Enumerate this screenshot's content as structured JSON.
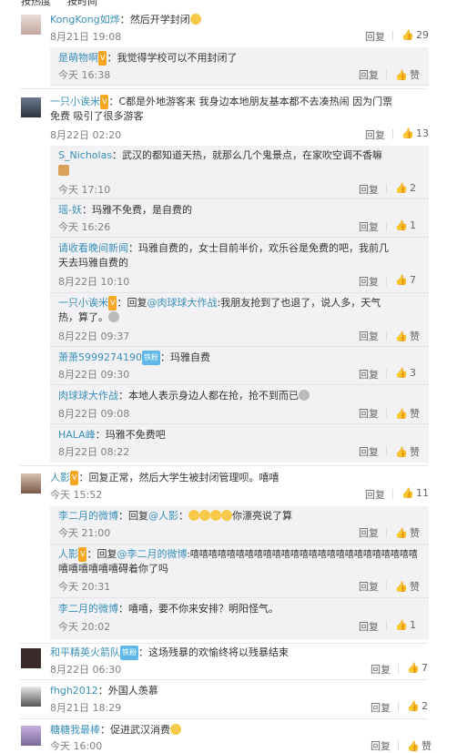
{
  "tabs": [
    "按热度",
    "按时间"
  ],
  "ui": {
    "reply": "回复",
    "zan": "赞"
  },
  "c1": {
    "name": "KongKong如烨",
    "text": "：然后开学封闭",
    "time": "8月21日 19:08",
    "likes": "29",
    "replies": [
      {
        "name": "是萌物啊",
        "text": "：我觉得学校可以不用封闭了",
        "time": "今天 16:38"
      }
    ]
  },
  "c2": {
    "name": "一只小诶米",
    "text1": "：C都是外地游客来 我身边本地朋友基本都不去凑热闹 因为门票",
    "text2": "免费 吸引了很多游客",
    "time": "8月22日 02:20",
    "likes": "13",
    "replies": [
      {
        "name": "S_Nicholas",
        "text": "：武汉的都知道天热，就那么几个鬼景点，在家吹空调不香嘛",
        "time": "今天 17:10",
        "likes": "2"
      },
      {
        "name": "瑶-妖",
        "text": "：玛雅不免费，是自费的",
        "time": "今天 16:26",
        "likes": "1"
      },
      {
        "name": "请收看晚间新闻",
        "text1": "：玛雅自费的，女士目前半价，欢乐谷是免费的吧，我前几",
        "text2": "天去玛雅自费的",
        "time": "8月22日 10:10",
        "likes": "7"
      },
      {
        "name": "一只小诶米",
        "reply_prefix": "：回复",
        "at": "@肉球球大作战",
        "text1": ":我朋友抢到了也退了，说人多，天气",
        "text2": "热，算了。",
        "time": "8月22日 09:37"
      },
      {
        "name": "萧萧5999274190",
        "text": "：玛雅自费",
        "time": "8月22日 09:30",
        "likes": "3"
      },
      {
        "name": "肉球球大作战",
        "text": "：本地人表示身边人都在抢，抢不到而已",
        "time": "8月22日 09:08"
      },
      {
        "name": "HALA峰",
        "text": "：玛雅不免费吧",
        "time": "8月22日 08:22"
      }
    ]
  },
  "c3": {
    "name": "人影",
    "text": "：回复正常，然后大学生被封闭管理呗。嘻嘻",
    "time": "今天 15:52",
    "likes": "11",
    "replies": [
      {
        "name": "李二月的微博",
        "reply_prefix": "：回复",
        "at": "@人影",
        "text": "：",
        "text_end": "你漂亮说了算",
        "time": "今天 21:00"
      },
      {
        "name": "人影",
        "reply_prefix": "：回复",
        "at": "@李二月的微博",
        "text1": ":嘻嘻嘻嘻嘻嘻嘻嘻嘻嘻嘻嘻嘻嘻嘻嘻嘻嘻嘻嘻嘻嘻嘻嘻嘻",
        "text2": "嘻嘻嘻嘻嘻嘻碍着你了吗",
        "time": "今天 20:31"
      },
      {
        "name": "李二月的微博",
        "text": "：嘻嘻，要不你来安排？明阳怪气。",
        "time": "今天 20:02",
        "likes": "1"
      }
    ]
  },
  "c4": {
    "name": "和平精英火箭队",
    "text": "：这场残暴的欢愉终将以残暴结束",
    "time": "8月22日 06:30",
    "likes": "7"
  },
  "c5": {
    "name": "fhgh2012",
    "text": "：外国人羡慕",
    "time": "8月21日 18:29",
    "likes": "2"
  },
  "c6": {
    "name": "糖糖我最棒",
    "text": "：促进武汉消费",
    "time": "今天 16:00"
  }
}
